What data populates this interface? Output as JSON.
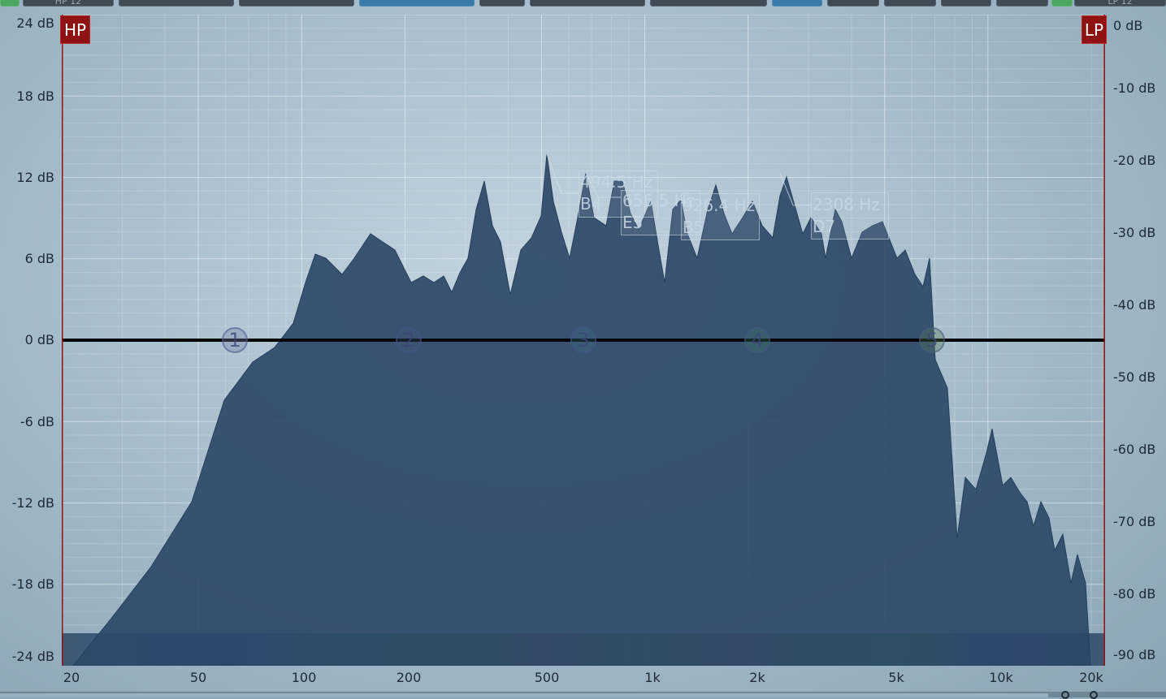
{
  "topbar": {
    "left_label": "HP 12",
    "right_label": "LP 12"
  },
  "filters": {
    "hp_badge": "HP",
    "lp_badge": "LP"
  },
  "axes": {
    "left_ticks": [
      "24 dB",
      "18 dB",
      "12 dB",
      "6 dB",
      "0 dB",
      "-6 dB",
      "-12 dB",
      "-18 dB",
      "-24 dB"
    ],
    "right_ticks": [
      "0 dB",
      "-10 dB",
      "-20 dB",
      "-30 dB",
      "-40 dB",
      "-50 dB",
      "-60 dB",
      "-70 dB",
      "-80 dB",
      "-90 dB"
    ],
    "x_ticks": [
      "20",
      "50",
      "100",
      "200",
      "500",
      "1k",
      "2k",
      "5k",
      "10k",
      "20k"
    ]
  },
  "bands": [
    "1",
    "2",
    "3",
    "4",
    "5"
  ],
  "peaks": [
    {
      "freq": "494.5 Hz",
      "note": "B4"
    },
    {
      "freq": "656.5 Hz",
      "note": "E5"
    },
    {
      "freq": "926.4 Hz",
      "note": "B5"
    },
    {
      "freq": "2308 Hz",
      "note": "D7"
    }
  ],
  "colors": {
    "spectrum_fill": "#2e4868",
    "filter_line": "#8e1212",
    "zero_line": "#000000"
  }
}
